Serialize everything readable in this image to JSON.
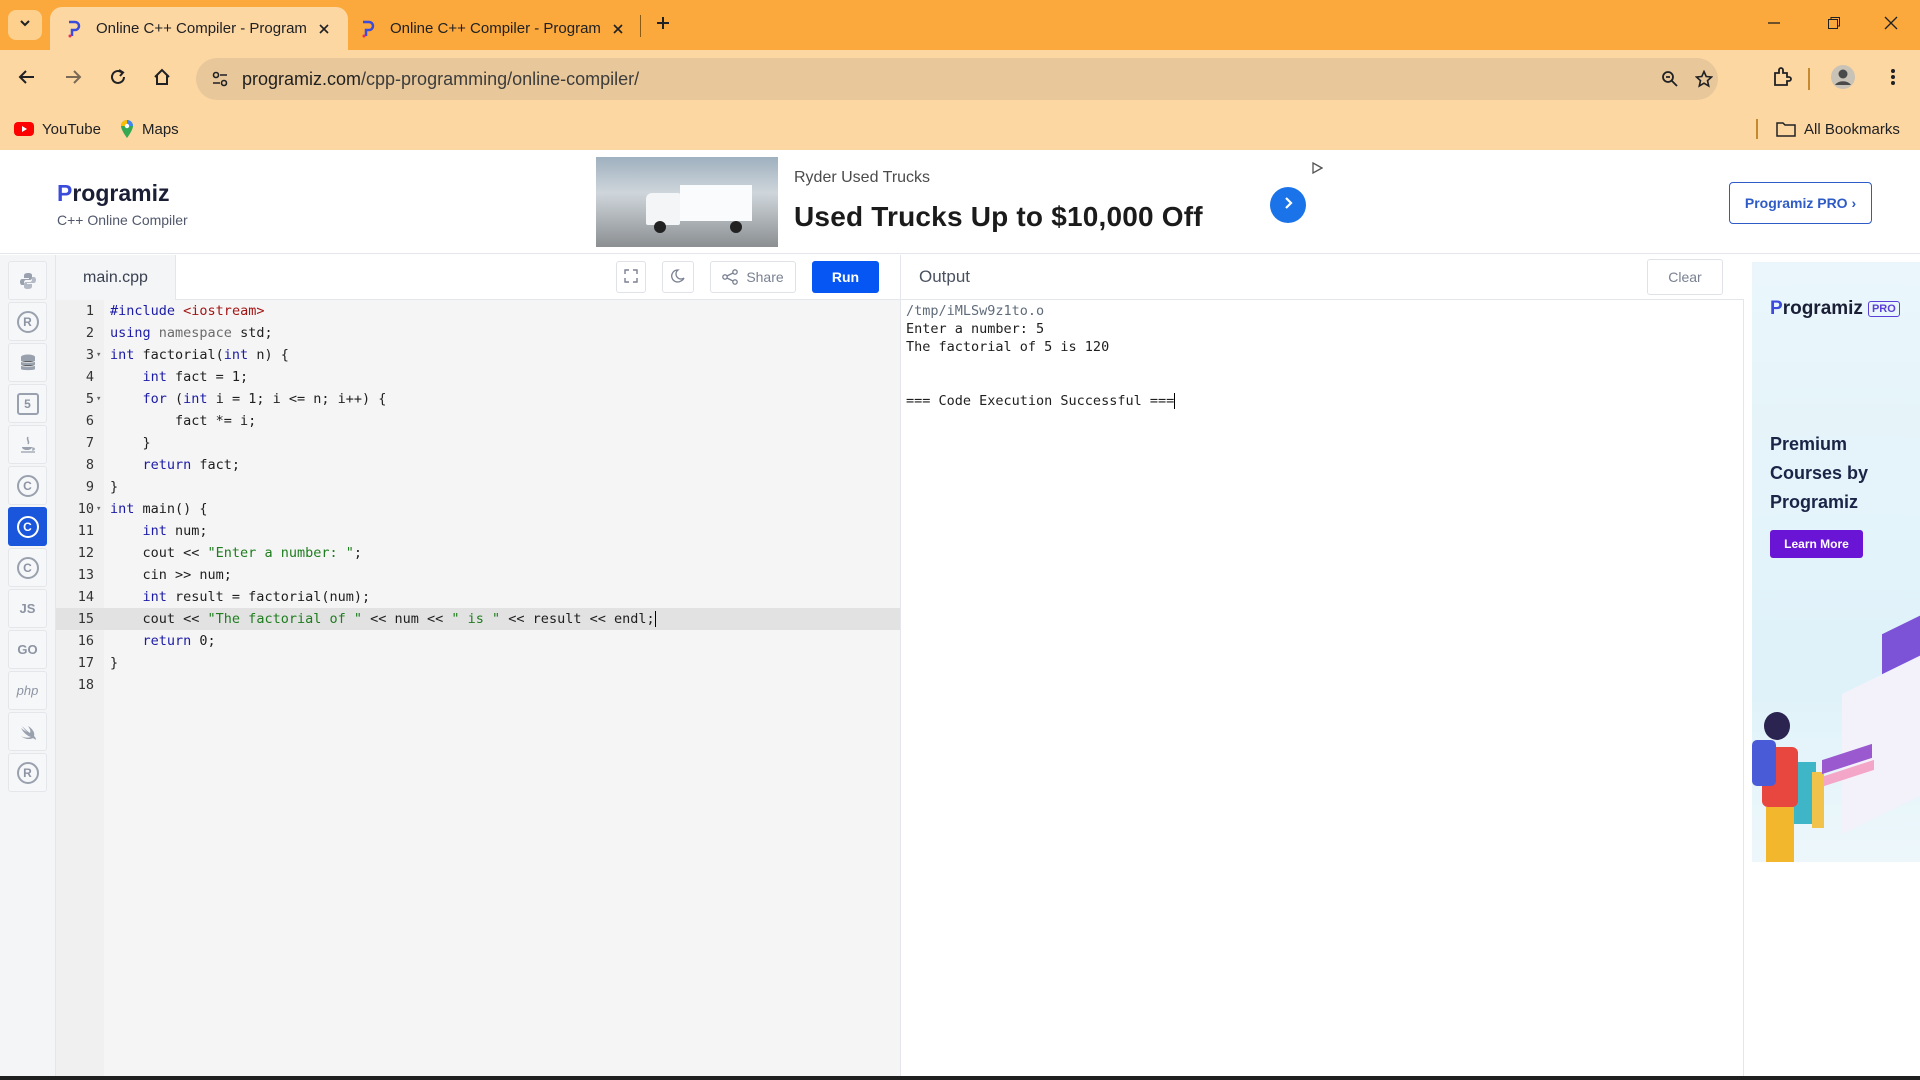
{
  "browser": {
    "tabs": [
      {
        "title": "Online C++ Compiler - Programiz",
        "active": true
      },
      {
        "title": "Online C++ Compiler - Programiz",
        "active": false
      }
    ],
    "url_host": "programiz.com",
    "url_path": "/cpp-programming/online-compiler/",
    "bookmarks": [
      {
        "label": "YouTube",
        "icon": "youtube-icon"
      },
      {
        "label": "Maps",
        "icon": "maps-icon"
      }
    ],
    "all_bookmarks": "All Bookmarks"
  },
  "header": {
    "logo_initial": "P",
    "logo_rest": "rogramiz",
    "subtitle": "C++ Online Compiler",
    "pro_button": "Programiz PRO ›"
  },
  "ad": {
    "advertiser": "Ryder Used Trucks",
    "headline": "Used Trucks Up to $10,000 Off"
  },
  "sidebar": {
    "languages": [
      {
        "name": "python",
        "glyph": "",
        "active": false
      },
      {
        "name": "r",
        "glyph": "R",
        "active": false
      },
      {
        "name": "sql",
        "glyph": "",
        "active": false
      },
      {
        "name": "html",
        "glyph": "5",
        "active": false
      },
      {
        "name": "java",
        "glyph": "",
        "active": false
      },
      {
        "name": "c",
        "glyph": "C",
        "active": false
      },
      {
        "name": "cpp",
        "glyph": "C",
        "active": true
      },
      {
        "name": "csharp",
        "glyph": "C",
        "active": false
      },
      {
        "name": "javascript",
        "glyph": "JS",
        "active": false
      },
      {
        "name": "go",
        "glyph": "GO",
        "active": false
      },
      {
        "name": "php",
        "glyph": "php",
        "active": false
      },
      {
        "name": "swift",
        "glyph": "",
        "active": false
      },
      {
        "name": "rust",
        "glyph": "R",
        "active": false
      }
    ]
  },
  "editor": {
    "filename": "main.cpp",
    "share_label": "Share",
    "run_label": "Run",
    "highlighted_line": 15,
    "lines": [
      "#include <iostream>",
      "using namespace std;",
      "int factorial(int n) {",
      "    int fact = 1;",
      "    for (int i = 1; i <= n; i++) {",
      "        fact *= i;",
      "    }",
      "    return fact;",
      "}",
      "int main() {",
      "    int num;",
      "    cout << \"Enter a number: \";",
      "    cin >> num;",
      "    int result = factorial(num);",
      "    cout << \"The factorial of \" << num << \" is \" << result << endl;",
      "    return 0;",
      "}",
      ""
    ],
    "foldable_lines": [
      3,
      5,
      10
    ]
  },
  "output": {
    "title": "Output",
    "clear_label": "Clear",
    "path": "/tmp/iMLSw9z1to.o",
    "line1": "Enter a number: 5",
    "line2": "The factorial of 5 is 120",
    "status": "=== Code Execution Successful ==="
  },
  "promo": {
    "logo_initial": "P",
    "logo_rest": "rogramiz",
    "pro_tag": "PRO",
    "headline": "Premium Courses by Programiz",
    "button": "Learn More"
  },
  "colors": {
    "chrome_tabbar": "#fba83c",
    "chrome_toolbar": "#fdd7a2",
    "run_button": "#0556f3",
    "active_language": "#1a56db",
    "promo_button": "#6a15d6"
  }
}
